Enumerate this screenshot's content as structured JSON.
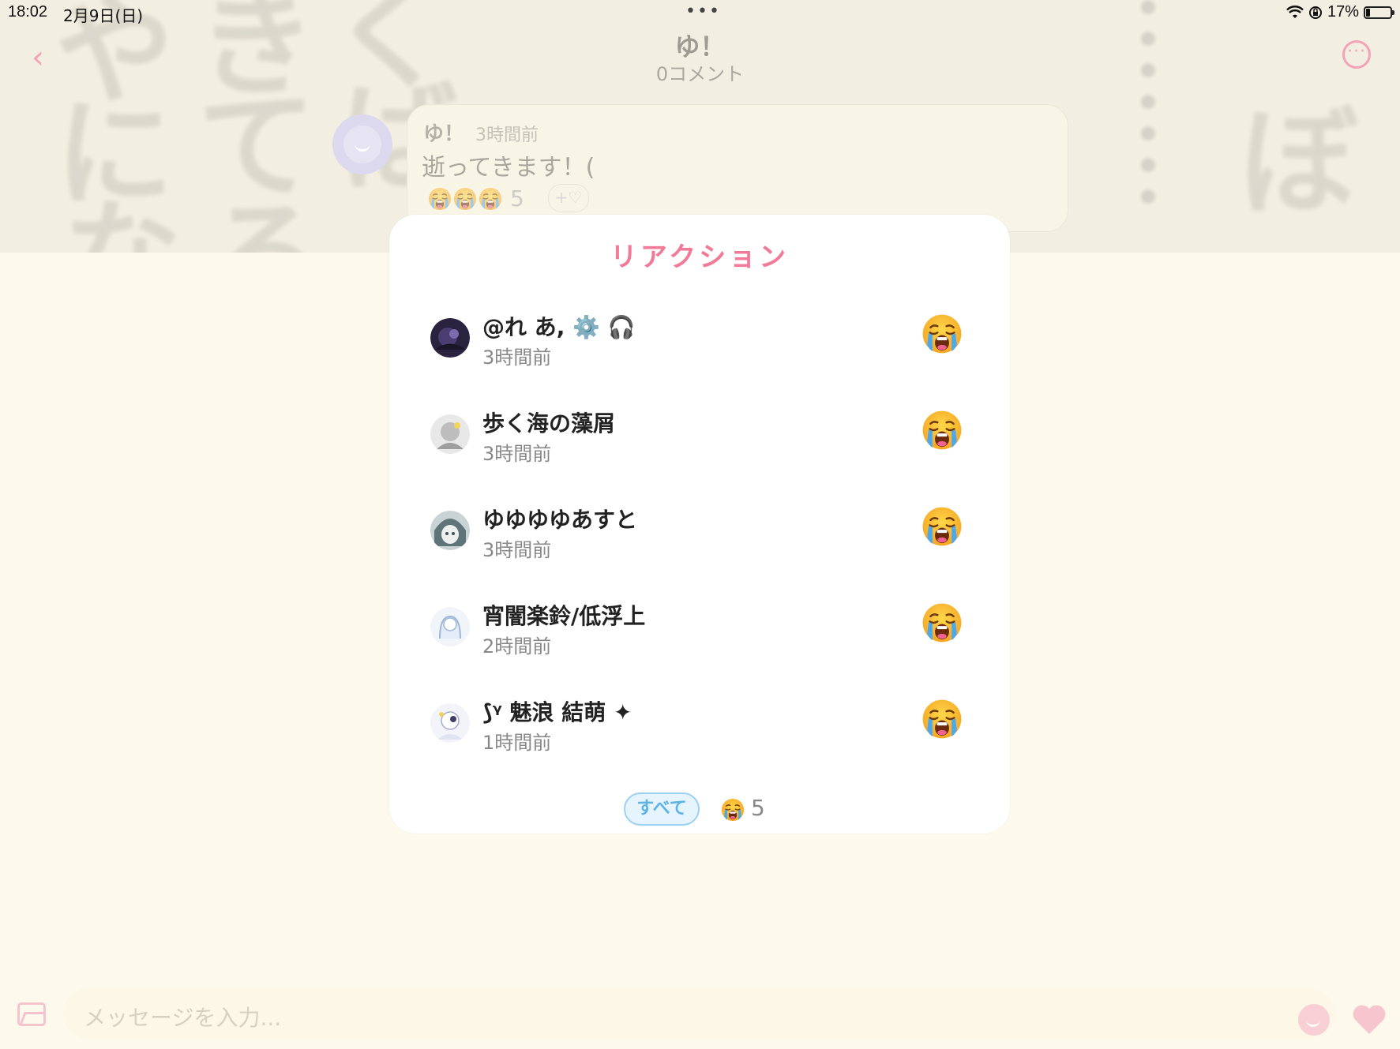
{
  "status_bar": {
    "time": "18:02",
    "date": "2月9日(日)",
    "dots": "•••",
    "battery": "17%"
  },
  "nav": {
    "back_icon": "‹",
    "title": "ゆ！",
    "subtitle": "0コメント",
    "more_icon": "···"
  },
  "background_text": [
    "や",
    "き",
    "く",
    "に",
    "て",
    "ば",
    "な",
    "る",
    "ぼ"
  ],
  "message": {
    "author": "ゆ！",
    "time": "3時間前",
    "text": "逝ってきます！(",
    "reaction_count": "5",
    "add_reaction_icon": "+♡"
  },
  "modal": {
    "title": "リアクション",
    "reactions": [
      {
        "name": "@れ あ, ⚙️ 🎧",
        "time": "3時間前",
        "emoji": "loudly-crying-face"
      },
      {
        "name": "歩く海の藻屑",
        "time": "3時間前",
        "emoji": "loudly-crying-face"
      },
      {
        "name": "ゆゆゆゆあすと",
        "time": "3時間前",
        "emoji": "loudly-crying-face"
      },
      {
        "name": "宵闇楽鈴/低浮上",
        "time": "2時間前",
        "emoji": "loudly-crying-face"
      },
      {
        "name": "⟆ᵞ 魅浪 結萌 ✦",
        "time": "1時間前",
        "emoji": "loudly-crying-face"
      }
    ],
    "filter_all": "すべて",
    "filter_count": "5"
  },
  "input": {
    "placeholder": "メッセージを入力..."
  },
  "colors": {
    "accent_pink": "#f07a98",
    "filter_blue": "#5fb2e6",
    "bg": "#fdf9ed"
  }
}
